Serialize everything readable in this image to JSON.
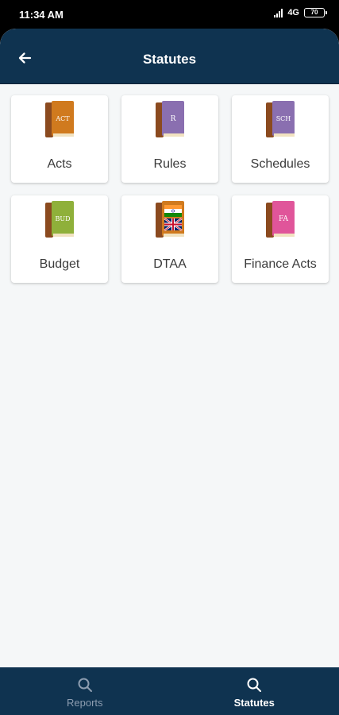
{
  "status_bar": {
    "time": "11:34 AM",
    "network": "4G",
    "battery": "70"
  },
  "header": {
    "title": "Statutes",
    "back_icon": "arrow-left-icon"
  },
  "tiles": [
    {
      "label": "Acts",
      "book_text": "ACT",
      "cover_color": "#d07a1e",
      "icon": "book-icon"
    },
    {
      "label": "Rules",
      "book_text": "R",
      "cover_color": "#8a6fb0",
      "icon": "book-icon"
    },
    {
      "label": "Schedules",
      "book_text": "SCH",
      "cover_color": "#8a6fb0",
      "icon": "book-icon"
    },
    {
      "label": "Budget",
      "book_text": "BUD",
      "cover_color": "#8fb03a",
      "icon": "book-icon"
    },
    {
      "label": "DTAA",
      "book_text": "",
      "cover_color": "#d07a1e",
      "icon": "flag-book-icon"
    },
    {
      "label": "Finance Acts",
      "book_text": "FA",
      "cover_color": "#e0559a",
      "icon": "book-icon"
    }
  ],
  "bottom_nav": [
    {
      "label": "Reports",
      "icon": "search-icon",
      "active": false
    },
    {
      "label": "Statutes",
      "icon": "search-icon",
      "active": true
    }
  ],
  "colors": {
    "primary": "#0f3350",
    "background": "#f5f7f8",
    "book_spine": "#8b4a1f"
  }
}
